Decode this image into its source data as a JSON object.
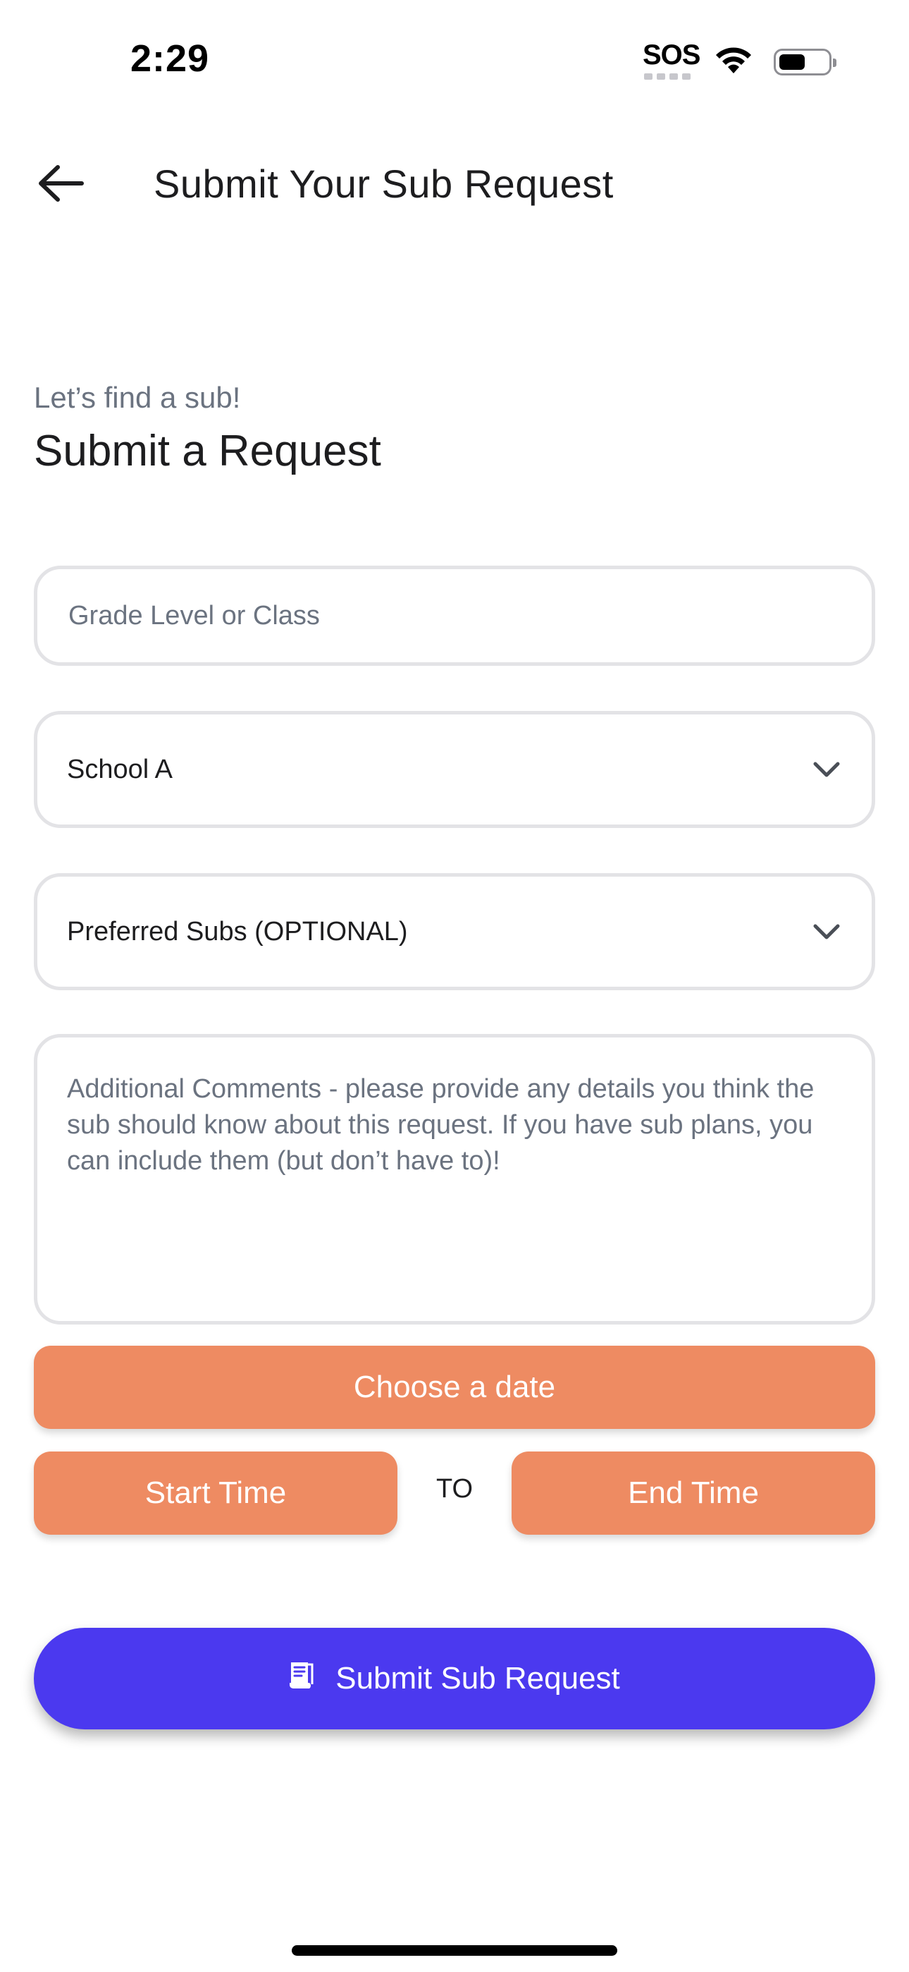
{
  "status_bar": {
    "time": "2:29",
    "sos_label": "SOS",
    "battery_level": 0.55
  },
  "header": {
    "title": "Submit Your Sub Request",
    "back_icon": "arrow-left-icon"
  },
  "intro": {
    "subtitle": "Let’s find a sub!",
    "heading": "Submit a Request"
  },
  "form": {
    "grade_placeholder": "Grade Level or Class",
    "grade_value": "",
    "school_selected": "School A",
    "preferred_subs_selected": "Preferred Subs (OPTIONAL)",
    "comments_placeholder": "Additional Comments - please provide any details you think the sub should know about this request. If you have sub plans, you can include them (but don’t have to)!",
    "comments_value": ""
  },
  "schedule": {
    "date_label": "Choose a date",
    "start_label": "Start Time",
    "to_label": "TO",
    "end_label": "End Time"
  },
  "submit": {
    "label": "Submit Sub Request",
    "icon": "receipt-icon"
  },
  "colors": {
    "accent_orange": "#ee8b62",
    "primary": "#4b39ef",
    "border": "#e3e3e6",
    "secondary_text": "#6b7380"
  }
}
